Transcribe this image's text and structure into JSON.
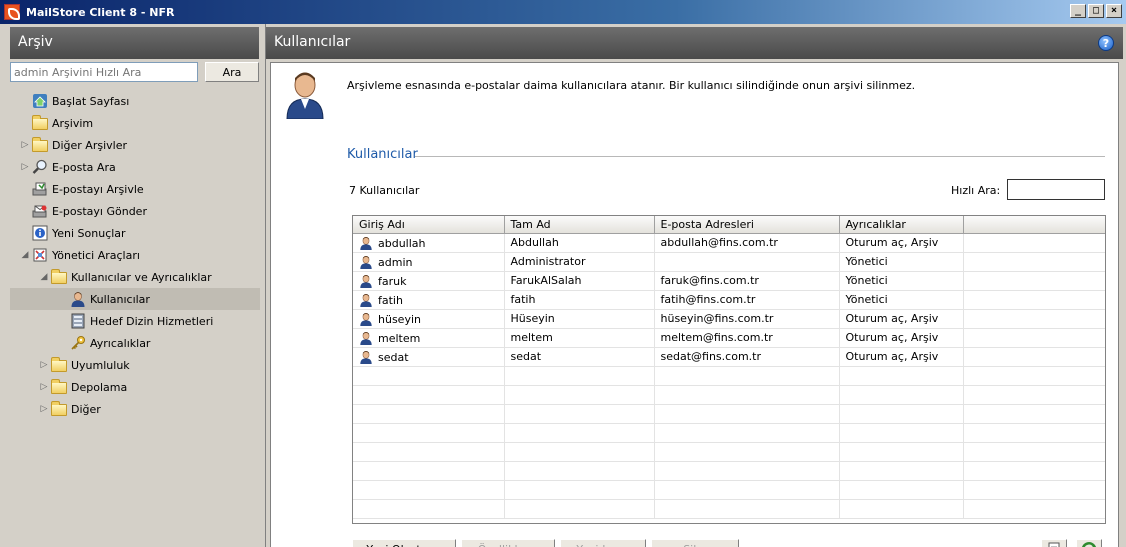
{
  "window": {
    "title": "MailStore Client 8 - NFR",
    "min": "_",
    "max": "□",
    "close": "×"
  },
  "left": {
    "header": "Arşiv",
    "search_placeholder": "admin Arşivini Hızlı Ara",
    "search_button": "Ara",
    "tree": [
      {
        "label": "Başlat Sayfası",
        "icon": "home-icon",
        "level": 0,
        "expander": ""
      },
      {
        "label": "Arşivim",
        "icon": "folder-icon",
        "level": 0,
        "expander": ""
      },
      {
        "label": "Diğer Arşivler",
        "icon": "folder-icon",
        "level": 0,
        "expander": "▷"
      },
      {
        "label": "E-posta Ara",
        "icon": "magnifier-icon",
        "level": 0,
        "expander": "▷"
      },
      {
        "label": "E-postayı Arşivle",
        "icon": "archive-mail-icon",
        "level": 0,
        "expander": ""
      },
      {
        "label": "E-postayı Gönder",
        "icon": "send-mail-icon",
        "level": 0,
        "expander": ""
      },
      {
        "label": "Yeni Sonuçlar",
        "icon": "info-icon",
        "level": 0,
        "expander": ""
      },
      {
        "label": "Yönetici Araçları",
        "icon": "admin-tools-icon",
        "level": 0,
        "expander": "◢"
      },
      {
        "label": "Kullanıcılar ve Ayrıcalıklar",
        "icon": "folder-icon",
        "level": 1,
        "expander": "◢"
      },
      {
        "label": "Kullanıcılar",
        "icon": "user-icon",
        "level": 2,
        "expander": ""
      },
      {
        "label": "Hedef Dizin Hizmetleri",
        "icon": "directory-icon",
        "level": 2,
        "expander": ""
      },
      {
        "label": "Ayrıcalıklar",
        "icon": "key-icon",
        "level": 2,
        "expander": ""
      },
      {
        "label": "Uyumluluk",
        "icon": "folder-icon",
        "level": 1,
        "expander": "▷"
      },
      {
        "label": "Depolama",
        "icon": "folder-icon",
        "level": 1,
        "expander": "▷"
      },
      {
        "label": "Diğer",
        "icon": "folder-icon",
        "level": 1,
        "expander": "▷"
      }
    ]
  },
  "main": {
    "header": "Kullanıcılar",
    "help": "?",
    "info": "Arşivleme esnasında e-postalar daima kullanıcılara atanır. Bir kullanıcı silindiğinde onun arşivi silinmez.",
    "section_title": "Kullanıcılar",
    "count": "7 Kullanıcılar",
    "quick_search_label": "Hızlı Ara:",
    "columns": [
      "Giriş Adı",
      "Tam Ad",
      "E-posta Adresleri",
      "Ayrıcalıklar"
    ],
    "rows": [
      [
        "abdullah",
        "Abdullah",
        "abdullah@fins.com.tr",
        "Oturum aç, Arşiv"
      ],
      [
        "admin",
        "Administrator",
        "",
        "Yönetici"
      ],
      [
        "faruk",
        "FarukAlSalah",
        "faruk@fins.com.tr",
        "Yönetici"
      ],
      [
        "fatih",
        "fatih",
        "fatih@fins.com.tr",
        "Yönetici"
      ],
      [
        "hüseyin",
        "Hüseyin",
        "hüseyin@fins.com.tr",
        "Oturum aç, Arşiv"
      ],
      [
        "meltem",
        "meltem",
        "meltem@fins.com.tr",
        "Oturum aç, Arşiv"
      ],
      [
        "sedat",
        "sedat",
        "sedat@fins.com.tr",
        "Oturum aç, Arşiv"
      ]
    ],
    "buttons": [
      "Yeni Oluştur...",
      "Özellikler...",
      "Yeniden...",
      "Sil..."
    ]
  }
}
